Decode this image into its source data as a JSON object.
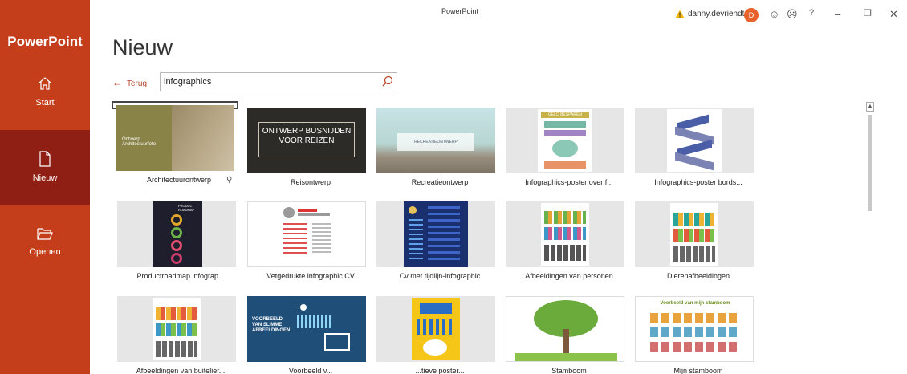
{
  "window": {
    "title": "PowerPoint",
    "user": "danny.devriendt",
    "avatar_initial": "D"
  },
  "sidebar": {
    "brand": "PowerPoint",
    "items": [
      {
        "label": "Start",
        "icon": "home-icon"
      },
      {
        "label": "Nieuw",
        "icon": "new-file-icon"
      },
      {
        "label": "Openen",
        "icon": "folder-icon"
      }
    ]
  },
  "main": {
    "title": "Nieuw",
    "back_label": "Terug",
    "search": {
      "value": "infographics"
    }
  },
  "templates": [
    {
      "label": "Architectuurontwerp",
      "thumb_text": "Ontwerp Architectuurfoto",
      "selected": true
    },
    {
      "label": "Reisontwerp",
      "thumb_text": "ONTWERP BUSNIJDEN VOOR REIZEN"
    },
    {
      "label": "Recreatieontwerp",
      "thumb_text": "RECREATIEONTWERP"
    },
    {
      "label": "Infographics-poster over f...",
      "thumb_text": "GELD BESPAREN"
    },
    {
      "label": "Infographics-poster bords..."
    },
    {
      "label": "Productroadmap infograp...",
      "thumb_text": "PRODUCT ROADMAP"
    },
    {
      "label": "Vetgedrukte infographic CV"
    },
    {
      "label": "Cv met tijdlijn-infographic"
    },
    {
      "label": "Afbeeldingen van personen"
    },
    {
      "label": "Dierenafbeeldingen"
    },
    {
      "label": "Afbeeldingen van buitelier..."
    },
    {
      "label": "Voorbeeld v...",
      "thumb_text": "VOORBEELD VAN SLIMME AFBEELDINGEN"
    },
    {
      "label": "...tieve poster..."
    },
    {
      "label": "Stamboom"
    },
    {
      "label": "Mijn stamboom",
      "thumb_text": "Voorbeeld van mijn stamboom"
    }
  ]
}
